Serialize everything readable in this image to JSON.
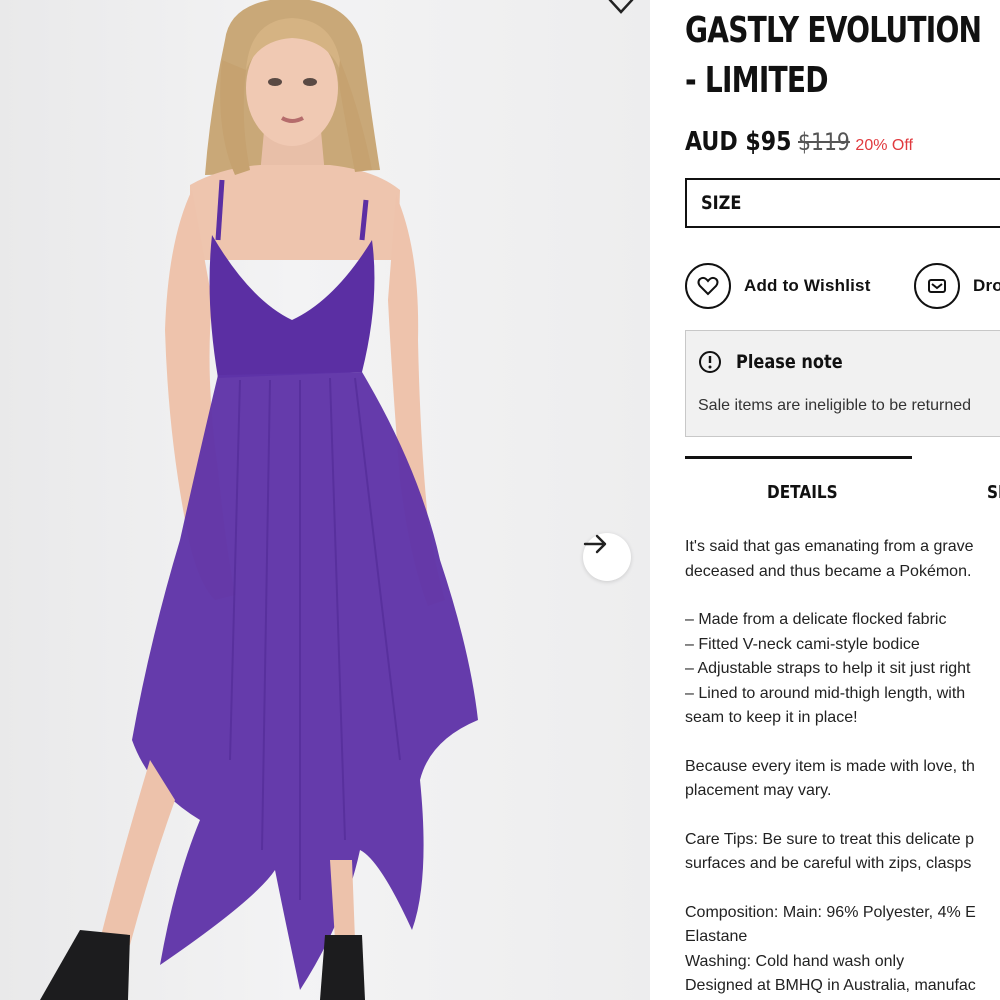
{
  "product": {
    "title_line1": "GASTLY EVOLUTION",
    "title_line2": "- LIMITED",
    "price": "AUD $95",
    "old_price": "$119",
    "discount": "20% Off"
  },
  "size": {
    "label": "SIZE"
  },
  "actions": {
    "wishlist": "Add to Wishlist",
    "drop": "Dro"
  },
  "note": {
    "title": "Please note",
    "body": "Sale items are ineligible to be returned"
  },
  "tabs": {
    "details": "DETAILS",
    "second": "SI"
  },
  "description": {
    "intro_1": "It's said that gas emanating from a grave",
    "intro_2": "deceased and thus became a Pokémon.",
    "features": [
      "– Made from a delicate flocked fabric",
      "– Fitted V-neck cami-style bodice",
      "– Adjustable straps to help it sit just right",
      "– Lined to around mid-thigh length, with",
      "seam to keep it in place!"
    ],
    "love_1": "Because every item is made with love, th",
    "love_2": "placement may vary.",
    "care_1": "Care Tips: Be sure to treat this delicate p",
    "care_2": "surfaces and be careful with zips, clasps",
    "comp_1": "Composition: Main: 96% Polyester, 4% E",
    "comp_2": "Elastane",
    "washing": "Washing: Cold hand wash only",
    "designed": "Designed at BMHQ in Australia, manufac"
  },
  "icons": {
    "next": "arrow-right-icon",
    "wishlist": "heart-icon",
    "drop": "mail-icon",
    "note": "exclamation-icon",
    "top": "heart-outline-icon"
  },
  "colors": {
    "dress": "#5b2fa3",
    "discount": "#e0393e",
    "note_bg": "#f1f1f1"
  }
}
